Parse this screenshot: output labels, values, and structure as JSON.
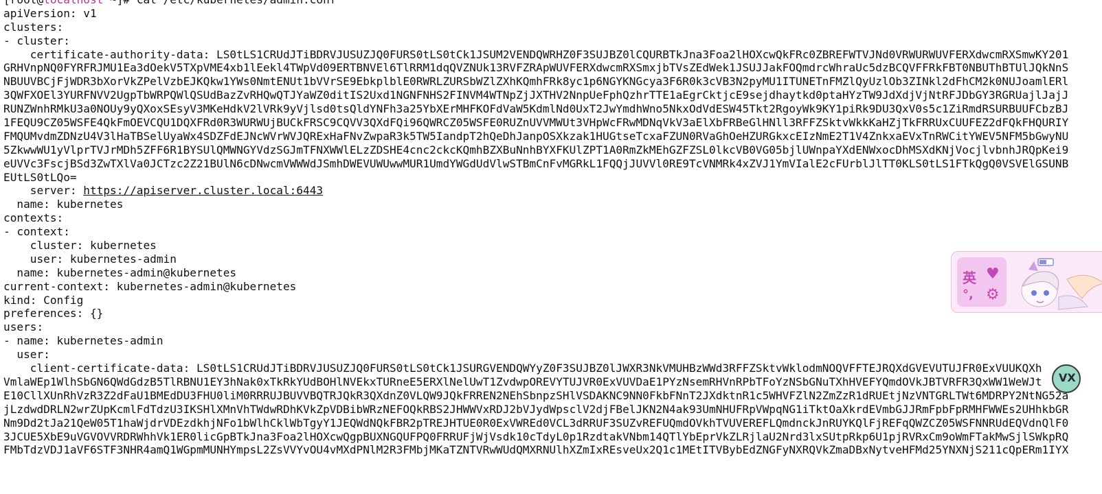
{
  "terminal": {
    "prompt": {
      "open": "[root@",
      "host": "localhost",
      "rest": " ~]# ",
      "command": "cat /etc/kubernetes/admin.conf"
    },
    "lines": [
      "apiVersion: v1",
      "clusters:",
      "- cluster:",
      "    certificate-authority-data: LS0tLS1CRUdJTiBDRVJUSUZJQ0FURS0tLS0tCk1JSUM2VENDQWRHZ0F3SUJBZ0lCQURBTkJna3Foa2lHOXcwQkFRc0ZBREFWTVJNd0VRWURWUVFERXdwcmRXSmwKY201",
      "GRHVnpNQ0FYRFRJMU1Ea3dOekV5TXpVME4xb1lEekl4TWpVd09ERTBNVEl6TlRRM1dqQVZNUk13RVFZRApWUVFERXdwcmRXSmxjbTVsZEdWek1JSUJJakFOQmdrcWhraUc5dzBCQVFFRkFBT0NBUThBTUlJQkNnS",
      "NBUUVBCjFjWDR3bXorVkZPelVzbEJKQkw1YWs0NmtENUt1bVVrSE9EbkplblE0RWRLZURSbWZlZXhKQmhFRk8yc1p6NGYKNGcya3F6R0k3cVB3N2pyMU1ITUNETnFMZlQyUzlOb3ZINkl2dFhCM2k0NUJoamlERl",
      "3QWFXOEl3YURFNVV2UgpTbWRPQWlQSUdBazZvRHQwQTJYaWZ0ditIS2Uxd1NGNFNHS2FINVM4WTNpZjJXTHV2NnpUeFphQzhrTTE1aEgrCktjcE9sejdhaytkd0ptaHYzTW9JdXdjVjNtRFJDbGY3RGRUajlJajJ",
      "RUNZWnhRMkU3a0NOUy9yQXoxSEsyV3MKeHdkV2lVRk9yVjlsd0tsQldYNFh3a25YbXErMHFKOFdVaW5KdmlNd0UxT2JwYmdhWno5NkxOdVdESW45Tkt2RgoyWk9KY1piRk9DU3QxV0s5c1ZiRmdRSURBUUFCbzBJ",
      "1FEQU9CZ05WSFE4QkFmOEVCQU1DQXFRd0R3WURWUjBUCkFRSC9CQVV3QXdFQi96QWRCZ05WSFE0RUZnUVVMWUt3VHpWcFRwMDNqVkV3aElXbFRBeGlHNll3RFFZSktvWkkKaHZjTkFRRUxCUUFEZ2dFQkFHQURIY",
      "FMQUMvdmZDNzU4V3lHaTBSelUyaWx4SDZFdEJNcWVrWVJQRExHaFNvZwpaR3k5TW5IandpT2hQeDhJanpOSXkzak1HUGtseTcxaFZUN0RVaGhOeHZURGkxcEIzNmE2T1V4ZnkxaEVxTnRWCitYWEV5NFM5bGwyNU",
      "5ZkwwWU1yVlprTVJrMDh5ZFF6R1BYSUlQMWNGYVdzSGJmTFNXWWlELzZDSHE4cnc2ckcKQmhBZXBuNnhBYXFKUlZPT1A0RmZkMEhGZFZSL0lkcVB0VG05bjlUWnpaYXdENWxocDhMSXdKNjVocjlvbnhJRQpKei9",
      "eUVVc3FscjBSd3ZwTXlVa0JCTzc2Z21BUlN6cDNwcmVWWWdJSmhDWEVUWUwwMUR1UmdYWGdUdVlwSTBmCnFvMGRkL1FQQjJUVVl0RE9TcVNMRk4xZVJ1YmVIalE2cFUrblJlTT0KLS0tLS1FTkQgQ0VSVElGSUNB",
      "EUtLS0tLQo=",
      "    server: https://apiserver.cluster.local:6443",
      "  name: kubernetes",
      "contexts:",
      "- context:",
      "    cluster: kubernetes",
      "    user: kubernetes-admin",
      "  name: kubernetes-admin@kubernetes",
      "current-context: kubernetes-admin@kubernetes",
      "kind: Config",
      "preferences: {}",
      "users:",
      "- name: kubernetes-admin",
      "  user:",
      "    client-certificate-data: LS0tLS1CRUdJTiBDRVJUSUZJQ0FURS0tLS0tCk1JSURGVENDQWYyZ0F3SUJBZ0lJWXR3NkVMUHBzWWd3RFFZSktvWklodmNOQVFFTEJRQXdGVEVUTUJFR0ExVUUKQXh",
      "VmlaWEp1WlhSbGN6QWdGdzB5TlRBNU1EY3hNak0xTkRkYUdBOHlNVEkxTURneE5ERXlNelUwT1ZvdwpOREVYTUJVR0ExVUVDaE1PYzNsemRHVnRPbTFoYzNSbGNuTXhHVEFYQmdOVkJBTVRFR3QxWW1WeWJt",
      "E10CllXUnRhVzR3Z2dFaU1BMEdDU3FHU0liM0RRRUJBUVVBQTRJQkR3QXdnZ0VLQW9JQkFRREN2NEhSbnpzSHlVSDAKNC9NN0FkbFNnT2JXdktnR1c5WHVFZlN2ZmZzR1dRUEtjNzVNTGRLTWt6MDRPY2NtNG52a",
      "jLzdwdDRLN2wrZUpKcmlFdTdzU3IKSHlXMnVhTWdwRDhKVkZpVDBibWRzNEFOQkRBS2JHWWVxRDJ2bVJydWpsclV2djFBelJKN2N4ak93UmNHUFRpVWpqNG1iTktOaXkrdEVmbGJJRmFpbFpRMHFWWEs2UHhkbGR",
      "Nm9Dd2tJa21QeW05T1haWjdrVDEzdkhjNFo1bWlhCklWbTgyY1JEQWdNQkFBR2pTREJHTUE0R0ExVWREd0VCL3dRRUF3SUZvREFUQmdOVkhTVUVEREFLQmdnckJnRUYKQlFjREFqQWZCZ05WSFNNRUdEQVdnQlF0",
      "3JCUE5XbE9uVGVOVVRDRWhhVk1ER0licGpBTkJna3Foa2lHOXcwQgpBUXNGQUFPQ0FRRUFjWjVsdk10cTdyL0p1RzdtakVNbm14QTlYbEprVkZLRjlaU2Nrd3lxSUtpRkp6U1pjRVRxCm9oWmFTakMwSjlSWkpRQ",
      "FMbTdzVDJ1aVF6STF3NHR4amQ1WGpmMUNHYmpsL2ZsVVYvOU4vMXdPNlM2R3FMbjMKaTZNTVRwWUdQMXRNUlhXZmIxREsveUx2Q1c1MEtITVBybEdZNGFyNXRQVkZmaDBxNytveHFMd25YNXNjS211cQpERm1IYX"
    ]
  },
  "ime": {
    "lang_glyph": "英",
    "heart_glyph": "♥",
    "punct_glyph": "°,",
    "gear_glyph": "⚙",
    "mascot_icon": "anime-mascot-icon",
    "colors": {
      "panel": "#f2c6ee",
      "glyph": "#c04bb5",
      "background": "#fbe9f7"
    }
  },
  "avatar": {
    "badge_text": "VX",
    "icon": "round-avatar-icon"
  },
  "colors": {
    "background": "#ffffff",
    "text": "#111111",
    "hostname": "#b6349a"
  }
}
